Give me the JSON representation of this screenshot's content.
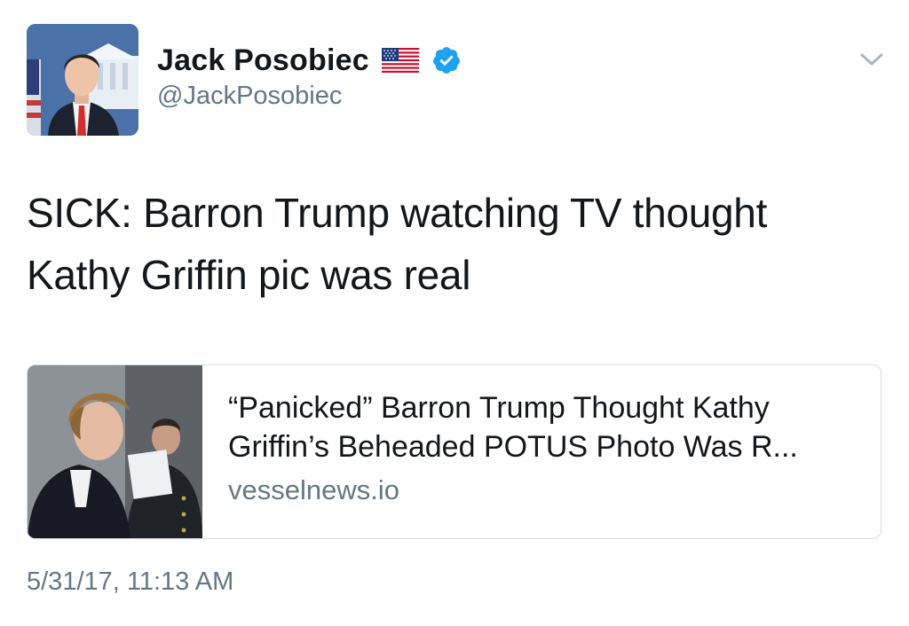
{
  "author": {
    "name": "Jack Posobiec",
    "handle": "@JackPosobiec",
    "flag_icon": "us-flag-emoji",
    "verified_icon": "verified-badge-icon",
    "verified_color": "#1da1f2"
  },
  "tweet": {
    "text": "SICK: Barron Trump watching TV thought Kathy Griffin pic was real",
    "timestamp": "5/31/17, 11:13 AM"
  },
  "link_card": {
    "title": "“Panicked” Barron Trump Thought Kathy Griffin’s Beheaded POTUS Photo Was R...",
    "domain": "vesselnews.io",
    "border_color": "#d6dde3"
  },
  "menu": {
    "icon": "chevron-down-icon"
  },
  "colors": {
    "text_primary": "#14171a",
    "text_secondary": "#657786",
    "background": "#ffffff"
  }
}
